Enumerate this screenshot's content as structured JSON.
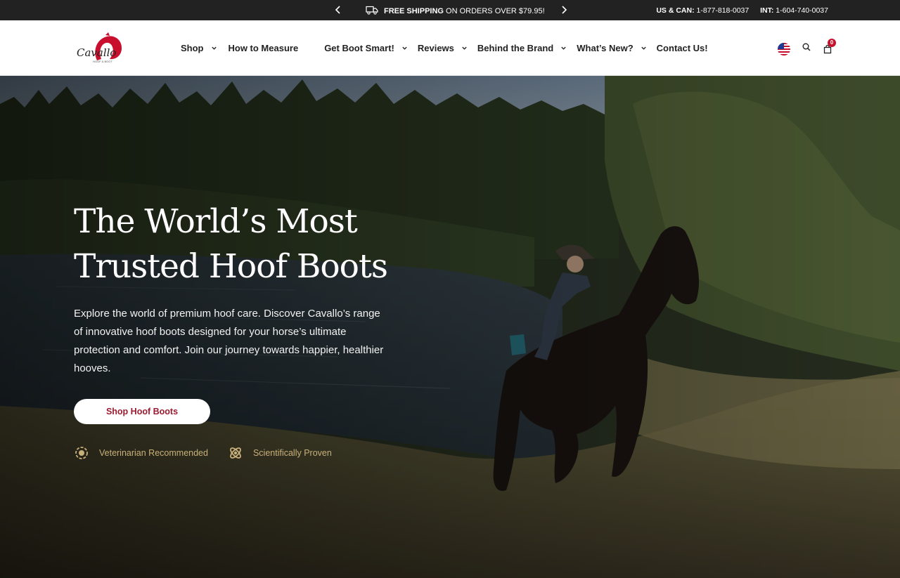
{
  "topbar": {
    "ship_strong": "FREE SHIPPING",
    "ship_rest": "ON ORDERS OVER $79.95!",
    "us_label": "US & CAN:",
    "us_phone": "1-877-818-0037",
    "int_label": "INT:",
    "int_phone": "1-604-740-0037"
  },
  "header": {
    "logo_text": "Cavallo",
    "logo_sub": "HOOF & BOOT",
    "cart_count": "0",
    "nav": [
      {
        "label": "Shop",
        "has_dropdown": true
      },
      {
        "label": "How to Measure",
        "has_dropdown": false
      },
      {
        "label": "Get Boot Smart!",
        "has_dropdown": true
      },
      {
        "label": "Reviews",
        "has_dropdown": true
      },
      {
        "label": "Behind the Brand",
        "has_dropdown": true
      },
      {
        "label": "What’s New?",
        "has_dropdown": true
      },
      {
        "label": "Contact Us!",
        "has_dropdown": false
      }
    ]
  },
  "hero": {
    "title_line1": "The World’s Most",
    "title_line2": "Trusted Hoof Boots",
    "description": "Explore the world of premium hoof care. Discover Cavallo’s range of innovative hoof boots designed for your horse’s ultimate protection and comfort. Join our journey towards happier, healthier hooves.",
    "cta_label": "Shop Hoof Boots",
    "badges": [
      {
        "label": "Veterinarian Recommended",
        "icon": "vet-badge-icon"
      },
      {
        "label": "Scientifically Proven",
        "icon": "atom-icon"
      }
    ]
  },
  "colors": {
    "topbar_bg": "#222222",
    "accent": "#9b1b30",
    "badge_gold": "#c8b07a",
    "cart_badge": "#c8102e"
  }
}
